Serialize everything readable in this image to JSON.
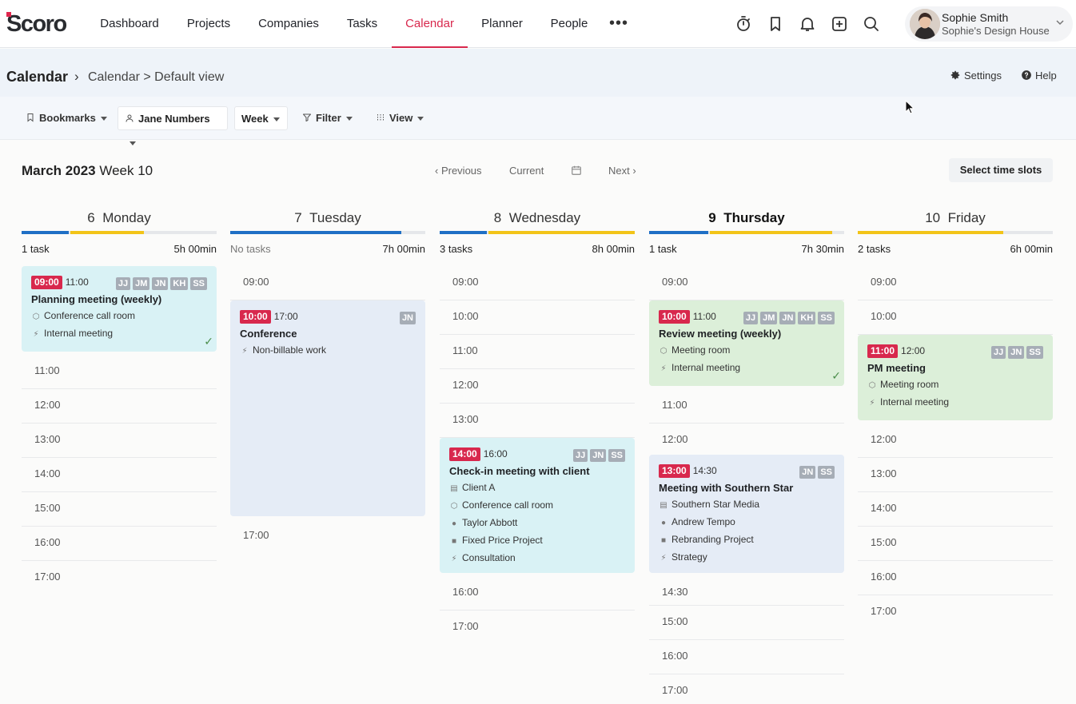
{
  "app": {
    "logo": "Scoro",
    "logo_accent": "#e0264d"
  },
  "nav": {
    "items": [
      {
        "label": "Dashboard",
        "active": false
      },
      {
        "label": "Projects",
        "active": false
      },
      {
        "label": "Companies",
        "active": false
      },
      {
        "label": "Tasks",
        "active": false
      },
      {
        "label": "Calendar",
        "active": true
      },
      {
        "label": "Planner",
        "active": false
      },
      {
        "label": "People",
        "active": false
      }
    ],
    "more_icon": "more-horizontal-icon",
    "tool_icons": [
      "timer-icon",
      "bookmark-icon",
      "bell-icon",
      "add-icon",
      "search-icon"
    ],
    "active_color": "#d8284d"
  },
  "user": {
    "name": "Sophie Smith",
    "company": "Sophie's Design House"
  },
  "page": {
    "title": "Calendar",
    "separator": "›",
    "breadcrumb": "Calendar > Default view",
    "settings_label": "Settings",
    "help_label": "Help"
  },
  "toolbar": {
    "bookmarks_label": "Bookmarks",
    "person_label": "Jane Numbers",
    "range_label": "Week",
    "filter_label": "Filter",
    "view_label": "View"
  },
  "week": {
    "month_label": "March 2023",
    "week_label": "Week 10",
    "previous_label": "Previous",
    "current_label": "Current",
    "next_label": "Next",
    "select_slots_label": "Select time slots"
  },
  "colors": {
    "event_cyan": "#d9f2f5",
    "event_blue": "#e5ecf6",
    "event_green": "#dcefd9",
    "cap_blue": "#1f6fc5",
    "cap_yellow": "#f2c418"
  },
  "days": [
    {
      "num": "6",
      "name": "Monday",
      "today": false,
      "tasks": "1 task",
      "duration": "5h 00min",
      "capacity": [
        {
          "color": "#1f6fc5",
          "fraction": 0.25
        },
        {
          "color": "#f2c418",
          "fraction": 0.38
        }
      ],
      "slots": [
        "11:00",
        "12:00",
        "13:00",
        "14:00",
        "15:00",
        "16:00",
        "17:00"
      ],
      "events": [
        {
          "color": "cyan",
          "start": "09:00",
          "end": "11:00",
          "title": "Planning meeting (weekly)",
          "tags": [
            "JJ",
            "JM",
            "JN",
            "KH",
            "SS"
          ],
          "meta": [
            {
              "icon": "cube-icon",
              "text": "Conference call room"
            },
            {
              "icon": "bolt-icon",
              "text": "Internal meeting"
            }
          ],
          "done": true
        }
      ]
    },
    {
      "num": "7",
      "name": "Tuesday",
      "today": false,
      "tasks": "No tasks",
      "duration": "7h 00min",
      "capacity": [
        {
          "color": "#1f6fc5",
          "fraction": 0.875
        }
      ],
      "slots": [
        "09:00",
        "17:00"
      ],
      "events": [
        {
          "color": "blue",
          "start": "10:00",
          "end": "17:00",
          "title": "Conference",
          "tags": [
            "JN"
          ],
          "meta": [
            {
              "icon": "bolt-icon",
              "text": "Non-billable work"
            }
          ],
          "done": false
        }
      ]
    },
    {
      "num": "8",
      "name": "Wednesday",
      "today": false,
      "tasks": "3 tasks",
      "duration": "8h 00min",
      "capacity": [
        {
          "color": "#1f6fc5",
          "fraction": 0.25
        },
        {
          "color": "#f2c418",
          "fraction": 0.75
        }
      ],
      "slots": [
        "09:00",
        "10:00",
        "11:00",
        "12:00",
        "13:00",
        "16:00",
        "17:00"
      ],
      "events": [
        {
          "color": "cyan",
          "start": "14:00",
          "end": "16:00",
          "title": "Check-in meeting with client",
          "tags": [
            "JJ",
            "JN",
            "SS"
          ],
          "meta": [
            {
              "icon": "building-icon",
              "text": "Client A"
            },
            {
              "icon": "cube-icon",
              "text": "Conference call room"
            },
            {
              "icon": "person-icon",
              "text": "Taylor Abbott"
            },
            {
              "icon": "briefcase-icon",
              "text": "Fixed Price Project"
            },
            {
              "icon": "bolt-icon",
              "text": "Consultation"
            }
          ],
          "done": false
        }
      ]
    },
    {
      "num": "9",
      "name": "Thursday",
      "today": true,
      "tasks": "1 task",
      "duration": "7h 30min",
      "capacity": [
        {
          "color": "#1f6fc5",
          "fraction": 0.31
        },
        {
          "color": "#f2c418",
          "fraction": 0.63
        }
      ],
      "slots": [
        "09:00",
        "11:00",
        "12:00",
        "14:30",
        "15:00",
        "16:00",
        "17:00"
      ],
      "events": [
        {
          "color": "green",
          "start": "10:00",
          "end": "11:00",
          "title": "Review meeting (weekly)",
          "tags": [
            "JJ",
            "JM",
            "JN",
            "KH",
            "SS"
          ],
          "meta": [
            {
              "icon": "cube-icon",
              "text": "Meeting room"
            },
            {
              "icon": "bolt-icon",
              "text": "Internal meeting"
            }
          ],
          "done": true
        },
        {
          "color": "blue",
          "start": "13:00",
          "end": "14:30",
          "title": "Meeting with Southern Star",
          "tags": [
            "JN",
            "SS"
          ],
          "meta": [
            {
              "icon": "building-icon",
              "text": "Southern Star Media"
            },
            {
              "icon": "person-icon",
              "text": "Andrew Tempo"
            },
            {
              "icon": "briefcase-icon",
              "text": "Rebranding Project"
            },
            {
              "icon": "bolt-icon",
              "text": "Strategy"
            }
          ],
          "done": false
        }
      ]
    },
    {
      "num": "10",
      "name": "Friday",
      "today": false,
      "tasks": "2 tasks",
      "duration": "6h 00min",
      "capacity": [
        {
          "color": "#f2c418",
          "fraction": 0.75
        }
      ],
      "slots": [
        "09:00",
        "10:00",
        "12:00",
        "13:00",
        "14:00",
        "15:00",
        "16:00",
        "17:00"
      ],
      "events": [
        {
          "color": "green",
          "start": "11:00",
          "end": "12:00",
          "title": "PM meeting",
          "tags": [
            "JJ",
            "JN",
            "SS"
          ],
          "meta": [
            {
              "icon": "cube-icon",
              "text": "Meeting room"
            },
            {
              "icon": "bolt-icon",
              "text": "Internal meeting"
            }
          ],
          "done": false
        }
      ]
    }
  ]
}
